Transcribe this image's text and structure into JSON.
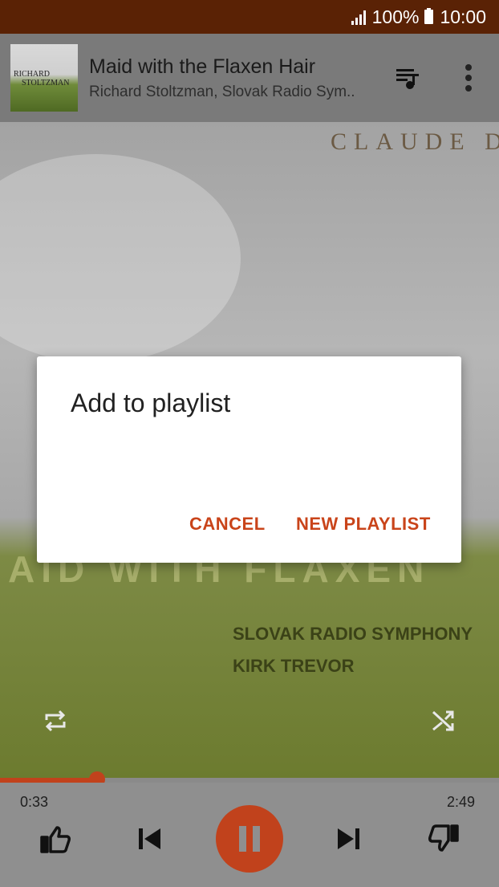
{
  "status_bar": {
    "battery": "100%",
    "time": "10:00"
  },
  "now_playing": {
    "title": "Maid with the Flaxen Hair",
    "subtitle": "Richard Stoltzman, Slovak Radio Sym..",
    "thumb_text_1": "RICHARD",
    "thumb_text_2": "STOLTZMAN"
  },
  "album_art": {
    "composer_text": "CLAUDE D",
    "title_text": "AID WITH FLAXEN",
    "orchestra_text": "SLOVAK RADIO SYMPHONY",
    "conductor_text": "KIRK TREVOR"
  },
  "player": {
    "elapsed": "0:33",
    "duration": "2:49",
    "progress_fraction": 0.195,
    "accent_color": "#c1421c"
  },
  "dialog": {
    "title": "Add to playlist",
    "cancel_label": "CANCEL",
    "new_playlist_label": "NEW PLAYLIST"
  },
  "icons": [
    "signal-icon",
    "battery-icon",
    "queue-icon",
    "more-vert-icon",
    "repeat-icon",
    "shuffle-icon",
    "thumbs-up-icon",
    "previous-icon",
    "pause-icon",
    "next-icon",
    "thumbs-down-icon"
  ]
}
